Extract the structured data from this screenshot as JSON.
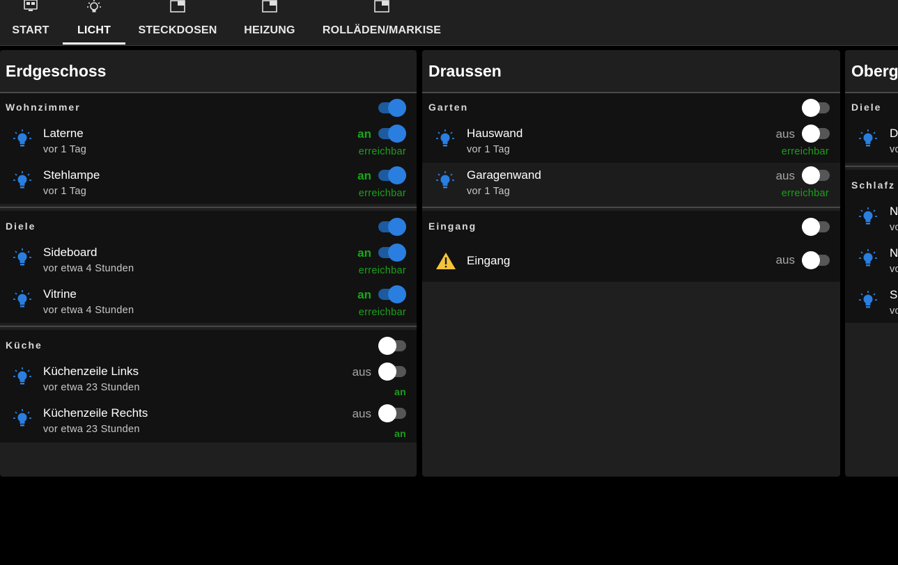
{
  "tabs": [
    {
      "label": "START",
      "icon": "monitor-icon"
    },
    {
      "label": "LICHT",
      "icon": "lightbulb-icon"
    },
    {
      "label": "STECKDOSEN",
      "icon": "window-icon"
    },
    {
      "label": "HEIZUNG",
      "icon": "window-icon"
    },
    {
      "label": "ROLLÄDEN/MARKISE",
      "icon": "window-icon"
    }
  ],
  "active_tab": "LICHT",
  "colors": {
    "accent": "#2a7ee0",
    "on_text": "#18a818",
    "off_text": "#a6a6a6",
    "bulb": "#2a7ee0",
    "warning": "#f5c33b"
  },
  "cards": [
    {
      "title": "Erdgeschoss",
      "groups": [
        {
          "title": "Wohnzimmer",
          "toggle": "on",
          "items": [
            {
              "name": "Laterne",
              "time": "vor 1 Tag",
              "state": "an",
              "reach": "erreichbar",
              "toggle": "on",
              "icon": "lightbulb-icon"
            },
            {
              "name": "Stehlampe",
              "time": "vor 1 Tag",
              "state": "an",
              "reach": "erreichbar",
              "toggle": "on",
              "icon": "lightbulb-icon"
            }
          ]
        },
        {
          "title": "Diele",
          "toggle": "on",
          "items": [
            {
              "name": "Sideboard",
              "time": "vor etwa 4 Stunden",
              "state": "an",
              "reach": "erreichbar",
              "toggle": "on",
              "icon": "lightbulb-icon"
            },
            {
              "name": "Vitrine",
              "time": "vor etwa 4 Stunden",
              "state": "an",
              "reach": "erreichbar",
              "toggle": "on",
              "icon": "lightbulb-icon"
            }
          ]
        },
        {
          "title": "Küche",
          "toggle": "off",
          "items": [
            {
              "name": "Küchenzeile Links",
              "time": "vor etwa 23 Stunden",
              "state": "aus",
              "reach": "an",
              "toggle": "off",
              "icon": "lightbulb-icon"
            },
            {
              "name": "Küchenzeile Rechts",
              "time": "vor etwa 23 Stunden",
              "state": "aus",
              "reach": "an",
              "toggle": "off",
              "icon": "lightbulb-icon"
            }
          ]
        }
      ]
    },
    {
      "title": "Draussen",
      "groups": [
        {
          "title": "Garten",
          "toggle": "off",
          "items": [
            {
              "name": "Hauswand",
              "time": "vor 1 Tag",
              "state": "aus",
              "reach": "erreichbar",
              "toggle": "off",
              "icon": "lightbulb-icon"
            },
            {
              "name": "Garagenwand",
              "time": "vor 1 Tag",
              "state": "aus",
              "reach": "erreichbar",
              "toggle": "off",
              "icon": "lightbulb-icon"
            }
          ]
        },
        {
          "title": "Eingang",
          "toggle": "off",
          "items": [
            {
              "name": "Eingang",
              "time": "",
              "state": "aus",
              "reach": "",
              "toggle": "off",
              "icon": "warning-icon"
            }
          ]
        }
      ]
    },
    {
      "title": "Oberg",
      "groups": [
        {
          "title": "Diele",
          "items": [
            {
              "name": "D",
              "time": "vo",
              "icon": "lightbulb-icon"
            }
          ]
        },
        {
          "title": "Schlafz",
          "items": [
            {
              "name": "N",
              "time": "vo",
              "icon": "lightbulb-icon"
            },
            {
              "name": "N",
              "time": "vo",
              "icon": "lightbulb-icon"
            },
            {
              "name": "S",
              "time": "vo",
              "icon": "lightbulb-icon"
            }
          ]
        }
      ]
    }
  ]
}
